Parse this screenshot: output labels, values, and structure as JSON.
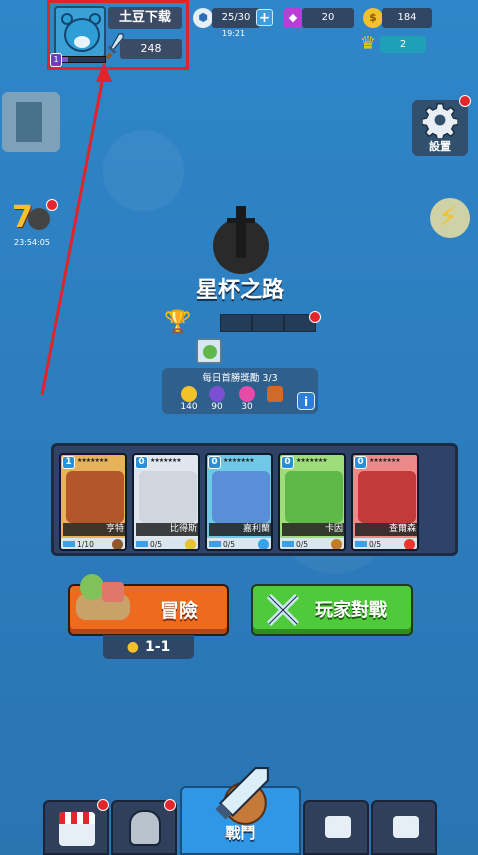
{
  "profile": {
    "name": "土豆下载",
    "level": "1",
    "power": "248",
    "xp_fraction": 0.15
  },
  "resources": {
    "energy": "25/30",
    "energy_timer": "19:21",
    "gems": "20",
    "coins": "184",
    "crowns": "2"
  },
  "side": {
    "event_timer": "23:54:05",
    "settings_label": "設置"
  },
  "main": {
    "mode_title": "星杯之路",
    "daily_title": "每日首勝獎勵 3/3",
    "rewards": [
      {
        "amount": "140",
        "icon": "coin-icon",
        "color": "#f3c12a"
      },
      {
        "amount": "90",
        "icon": "purple-gem-icon",
        "color": "#7a4fd2"
      },
      {
        "amount": "30",
        "icon": "star-token-icon",
        "color": "#e84aa8"
      },
      {
        "amount": "",
        "icon": "chest-icon",
        "color": "#d06a2b"
      }
    ],
    "info_label": "i"
  },
  "cards": [
    {
      "level": "1",
      "name": "亨特",
      "count": "1/10",
      "bg": "#e7b25a",
      "art": "#b5562a",
      "elem": "#8a5a2b",
      "lvbg": "#2a8fd6"
    },
    {
      "level": "0",
      "name": "比得斯",
      "count": "0/5",
      "bg": "#e0e6ee",
      "art": "#cfd6dd",
      "elem": "#e5c23a",
      "lvbg": "#2a8fd6"
    },
    {
      "level": "0",
      "name": "嘉利蘭",
      "count": "0/5",
      "bg": "#6ec8e6",
      "art": "#5a8ed6",
      "elem": "#3aa0e8",
      "lvbg": "#2a8fd6"
    },
    {
      "level": "0",
      "name": "卡因",
      "count": "0/5",
      "bg": "#9fdc7a",
      "art": "#5fb84a",
      "elem": "#c27a2e",
      "lvbg": "#2a8fd6"
    },
    {
      "level": "0",
      "name": "查爾森",
      "count": "0/5",
      "bg": "#ec8a8a",
      "art": "#c23a3a",
      "elem": "#e53a2a",
      "lvbg": "#2a8fd6"
    }
  ],
  "modes": {
    "adventure_label": "冒險",
    "stage": "1-1",
    "pvp_label": "玩家對戰"
  },
  "nav": {
    "battle_label": "戰鬥"
  },
  "colors": {
    "annotation": "#e0242a",
    "background": "#2f7fbf"
  }
}
